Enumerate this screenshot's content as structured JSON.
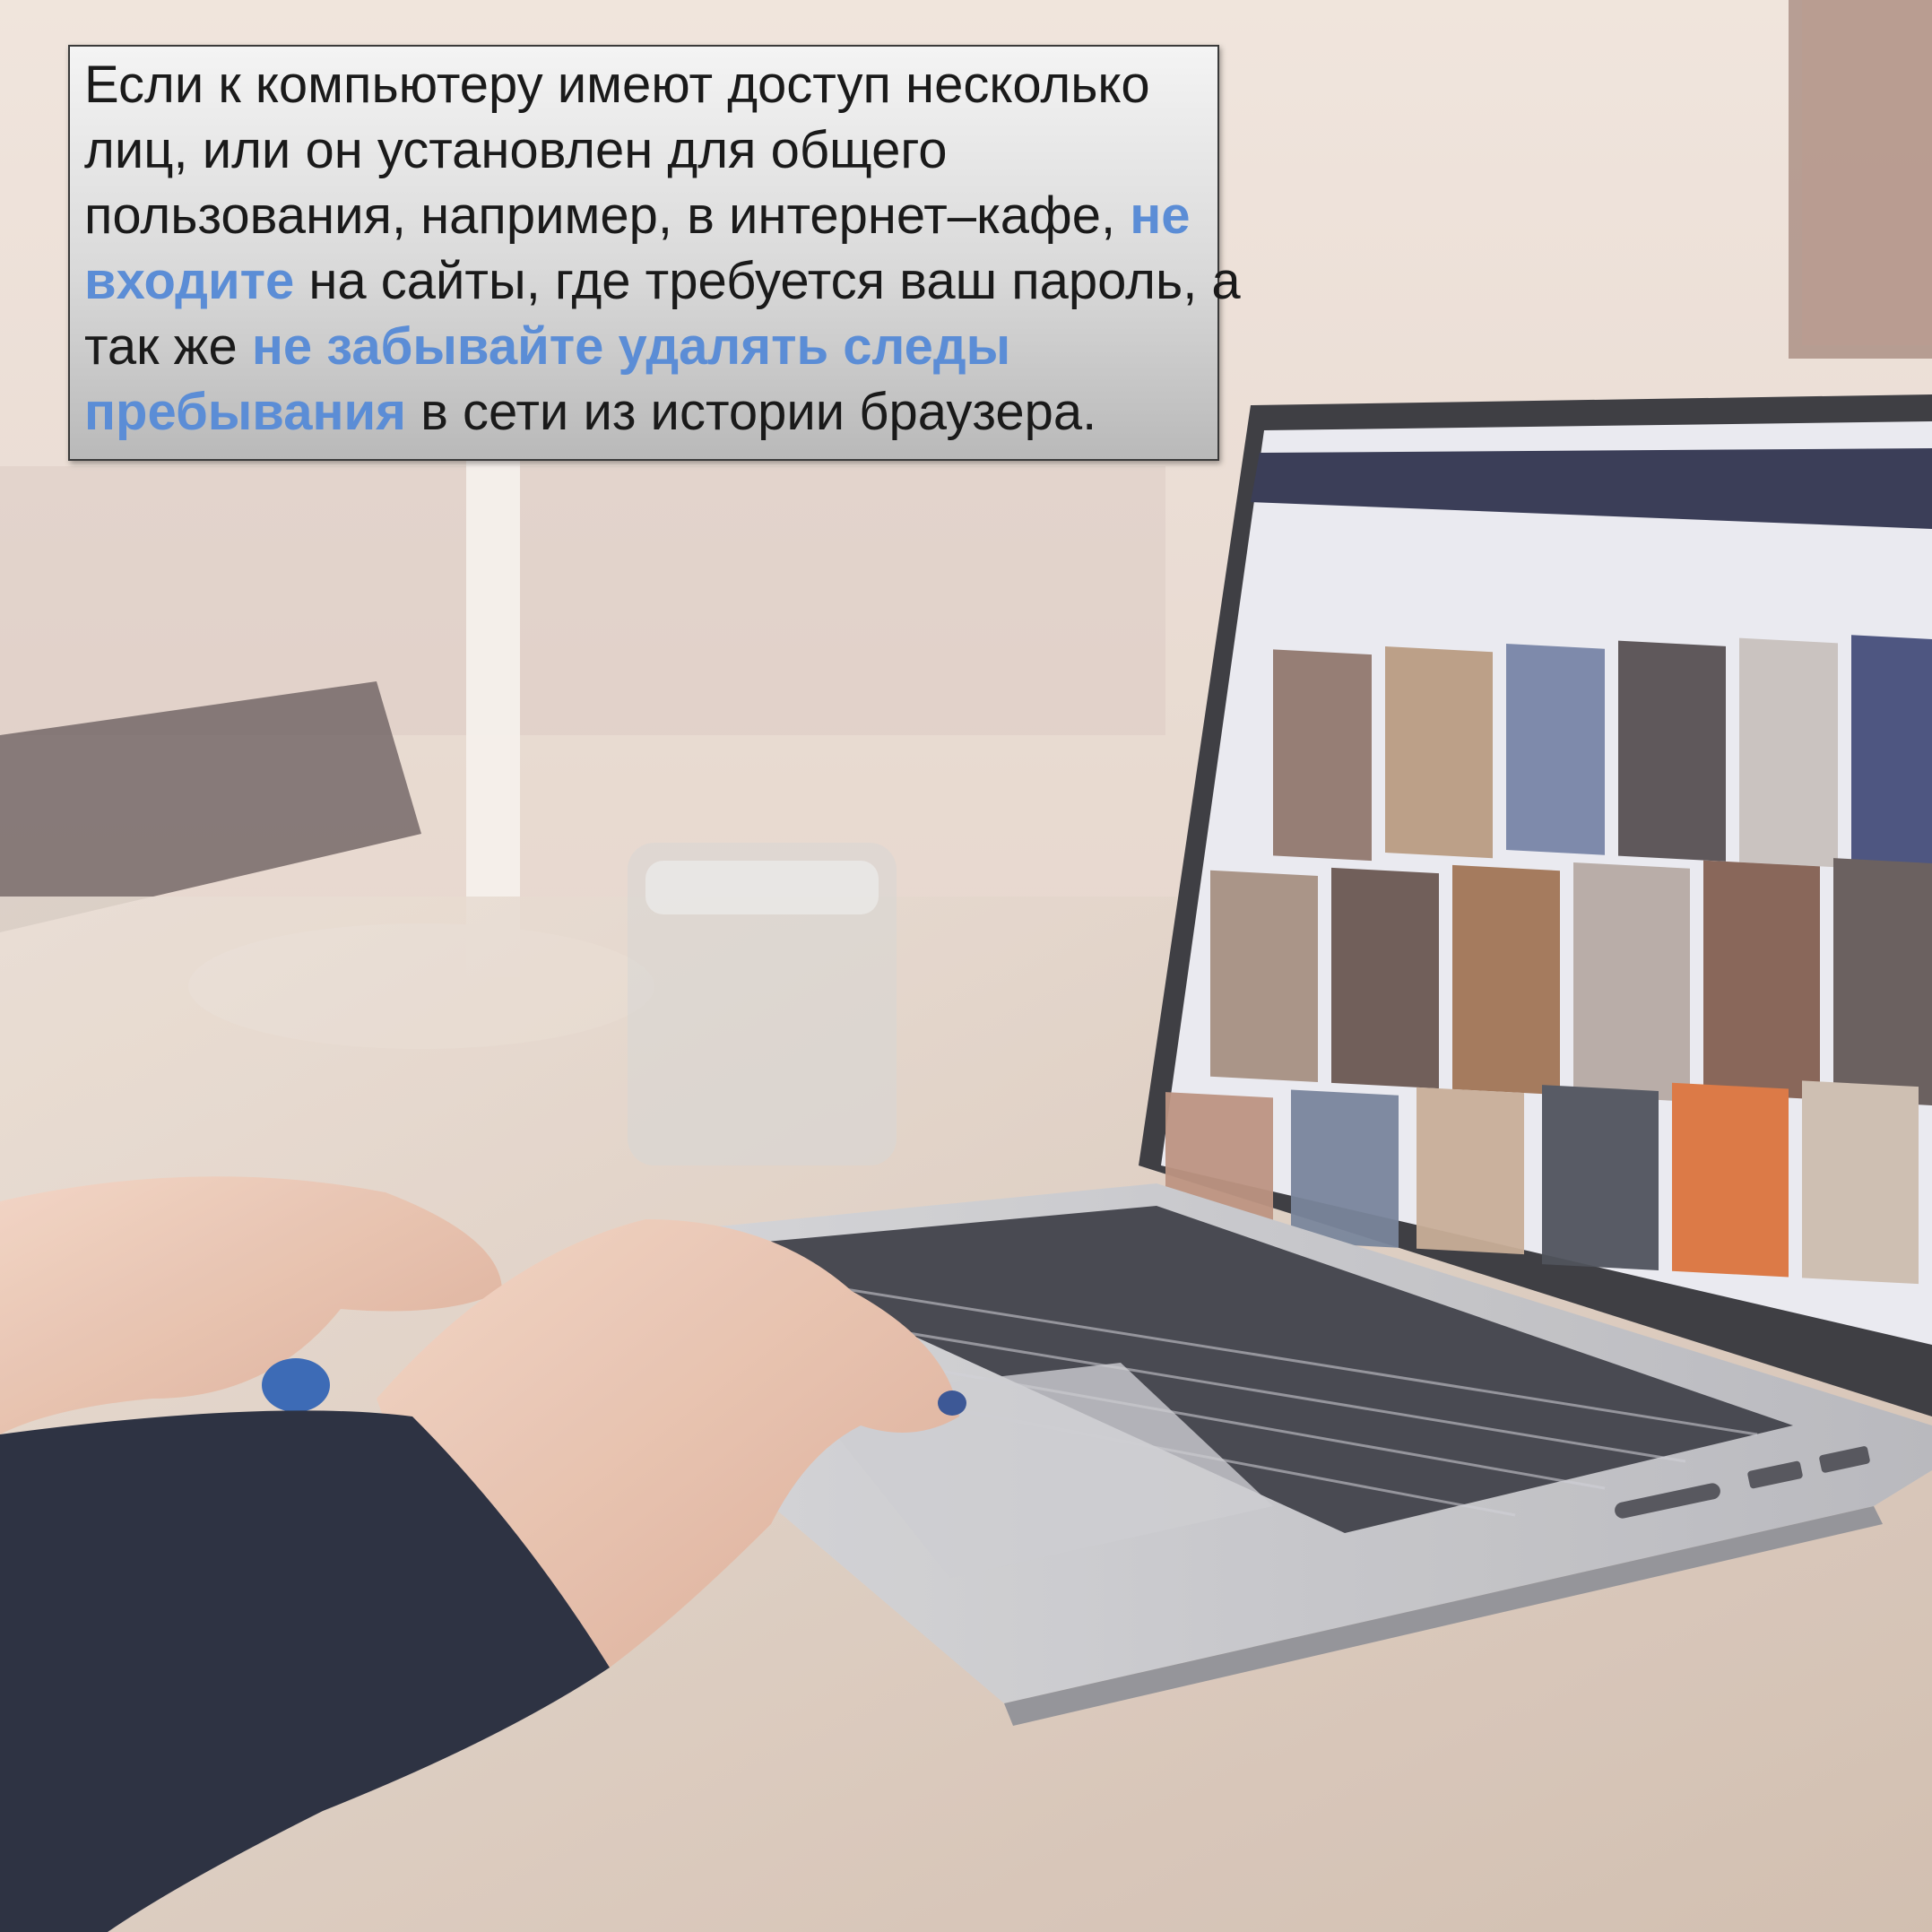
{
  "slide": {
    "caption": {
      "part1": "Если к компьютеру имеют доступ несколько лиц, или он установлен для общего пользования, например, в интернет–кафе, ",
      "highlight1": "не входите",
      "part2": " на сайты, где требуется ваш пароль, а так же ",
      "highlight2": "не забывайте удалять следы пребывания",
      "part3": " в сети из истории браузера."
    },
    "colors": {
      "highlight": "#5b8dd6",
      "text": "#1a1a1a"
    },
    "photo": {
      "icon": "laptop-photo"
    }
  }
}
